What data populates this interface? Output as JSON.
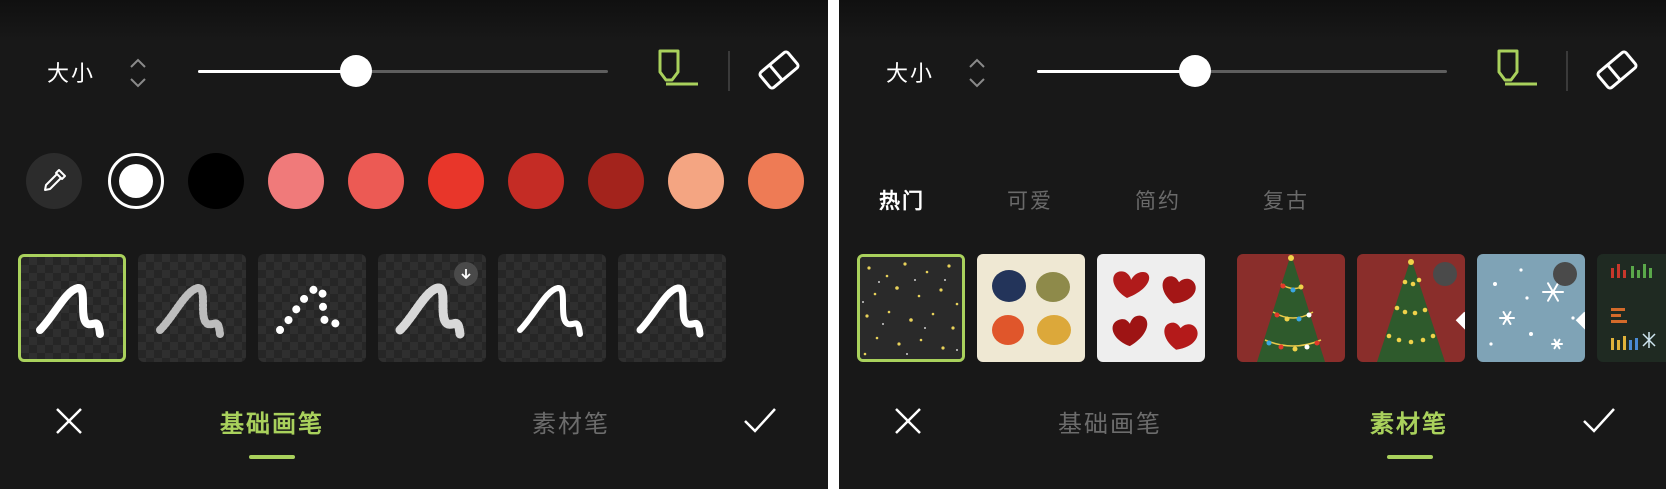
{
  "accent_color": "#a9d15c",
  "left_panel": {
    "size_label": "大小",
    "size_slider_value": 0.39,
    "tools": [
      "marker-icon",
      "eraser-icon"
    ],
    "active_tool": "marker-icon",
    "colors": [
      "#ffffff",
      "#000000",
      "#f07a7a",
      "#ec5a54",
      "#e8362a",
      "#c42c25",
      "#a3231c",
      "#f4a582",
      "#ee7b55"
    ],
    "selected_color": "#ffffff",
    "brushes": [
      "solid-brush",
      "pencil-brush",
      "dotted-brush",
      "crayon-brush",
      "calligraphy-brush",
      "marker-brush"
    ],
    "selected_brush": "solid-brush",
    "tabs": [
      "基础画笔",
      "素材笔"
    ],
    "active_tab": "基础画笔"
  },
  "right_panel": {
    "size_label": "大小",
    "size_slider_value": 0.39,
    "tools": [
      "marker-icon",
      "eraser-icon"
    ],
    "active_tool": "marker-icon",
    "categories": [
      "热门",
      "可爱",
      "简约",
      "复古"
    ],
    "active_category": "热门",
    "materials": [
      "sparkle-material",
      "color-dots-material",
      "hearts-material",
      "christmas-tree-material",
      "christmas-tree-lights-material",
      "snowflake-material",
      "pixel-pattern-material"
    ],
    "selected_material": "sparkle-material",
    "tabs": [
      "基础画笔",
      "素材笔"
    ],
    "active_tab": "素材笔"
  }
}
